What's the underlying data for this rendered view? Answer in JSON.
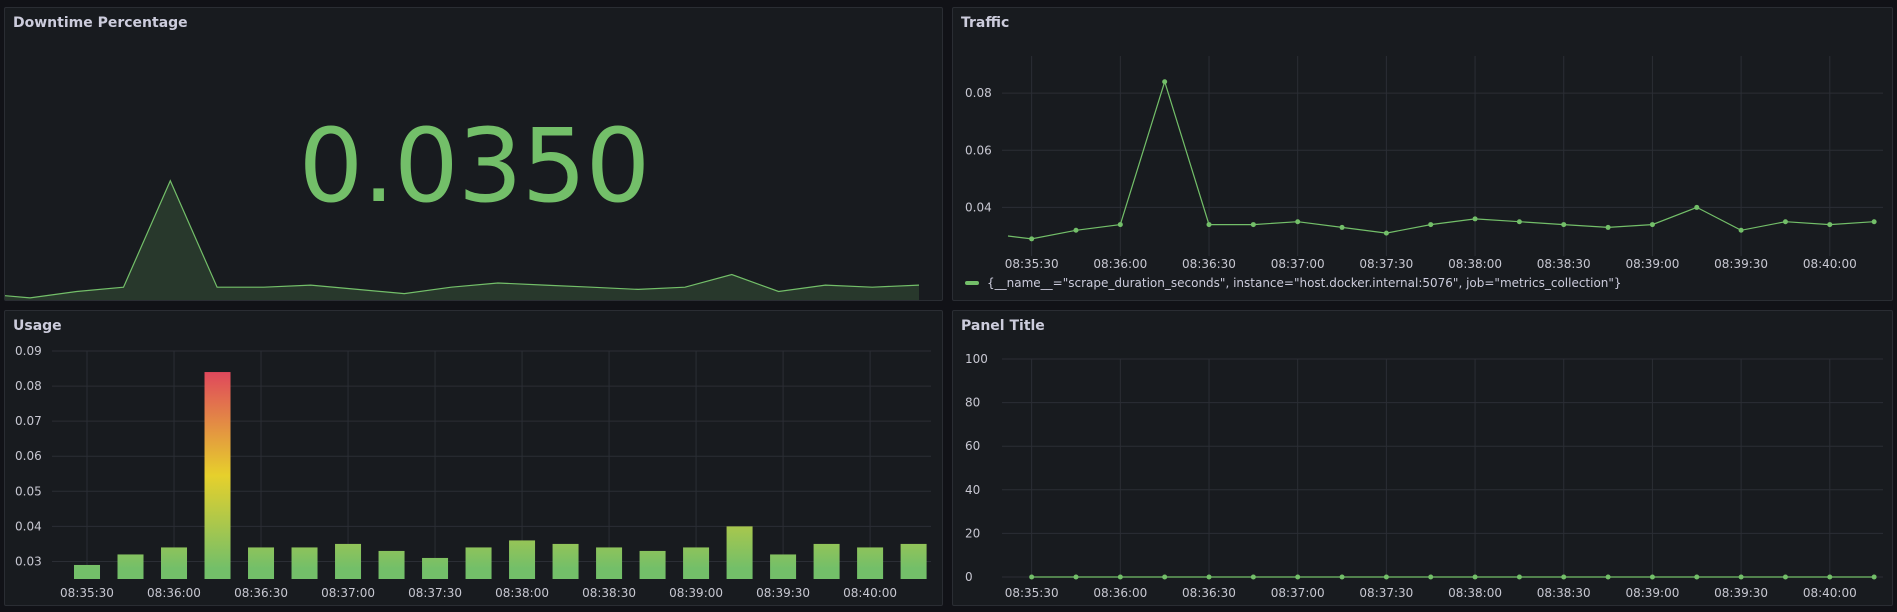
{
  "panels": {
    "downtime": {
      "title": "Downtime Percentage",
      "value": "0.0350"
    },
    "traffic": {
      "title": "Traffic",
      "legend": "{__name__=\"scrape_duration_seconds\", instance=\"host.docker.internal:5076\", job=\"metrics_collection\"}"
    },
    "usage": {
      "title": "Usage"
    },
    "panel4": {
      "title": "Panel Title"
    }
  },
  "colors": {
    "series": "#73bf69",
    "grid": "#2b2e35",
    "gradient_top": "#e0485c",
    "gradient_mid": "#e6d02c",
    "gradient_bottom": "#73bf69"
  },
  "chart_data": [
    {
      "panel": "downtime",
      "type": "area",
      "x": [
        "08:35:22",
        "08:35:30",
        "08:35:45",
        "08:36:00",
        "08:36:15",
        "08:36:30",
        "08:36:45",
        "08:37:00",
        "08:37:15",
        "08:37:30",
        "08:37:45",
        "08:38:00",
        "08:38:15",
        "08:38:30",
        "08:38:45",
        "08:39:00",
        "08:39:15",
        "08:39:30",
        "08:39:45",
        "08:40:00",
        "08:40:15"
      ],
      "values": [
        0.03,
        0.029,
        0.032,
        0.034,
        0.084,
        0.034,
        0.034,
        0.035,
        0.033,
        0.031,
        0.034,
        0.036,
        0.035,
        0.034,
        0.033,
        0.034,
        0.04,
        0.032,
        0.035,
        0.034,
        0.035
      ],
      "ylim": [
        0.028,
        0.09
      ],
      "title": "Downtime Percentage"
    },
    {
      "panel": "traffic",
      "type": "line",
      "x": [
        "08:35:22",
        "08:35:30",
        "08:35:45",
        "08:36:00",
        "08:36:15",
        "08:36:30",
        "08:36:45",
        "08:37:00",
        "08:37:15",
        "08:37:30",
        "08:37:45",
        "08:38:00",
        "08:38:15",
        "08:38:30",
        "08:38:45",
        "08:39:00",
        "08:39:15",
        "08:39:30",
        "08:39:45",
        "08:40:00",
        "08:40:15"
      ],
      "values": [
        0.03,
        0.029,
        0.032,
        0.034,
        0.084,
        0.034,
        0.034,
        0.035,
        0.033,
        0.031,
        0.034,
        0.036,
        0.035,
        0.034,
        0.033,
        0.034,
        0.04,
        0.032,
        0.035,
        0.034,
        0.035
      ],
      "points": [
        false,
        true,
        true,
        true,
        true,
        true,
        true,
        true,
        true,
        true,
        true,
        true,
        true,
        true,
        true,
        true,
        true,
        true,
        true,
        true,
        true
      ],
      "yticks": [
        "0.08",
        "0.06",
        "0.04"
      ],
      "ytick_values": [
        0.08,
        0.06,
        0.04
      ],
      "xticks": [
        "08:35:30",
        "08:36:00",
        "08:36:30",
        "08:37:00",
        "08:37:30",
        "08:38:00",
        "08:38:30",
        "08:39:00",
        "08:39:30",
        "08:40:00"
      ],
      "ylim": [
        0.023,
        0.093
      ],
      "grid": true,
      "title": "Traffic",
      "legend": "{__name__=\"scrape_duration_seconds\", instance=\"host.docker.internal:5076\", job=\"metrics_collection\"}"
    },
    {
      "panel": "usage",
      "type": "bar",
      "x": [
        "08:35:30",
        "08:35:45",
        "08:36:00",
        "08:36:15",
        "08:36:30",
        "08:36:45",
        "08:37:00",
        "08:37:15",
        "08:37:30",
        "08:37:45",
        "08:38:00",
        "08:38:15",
        "08:38:30",
        "08:38:45",
        "08:39:00",
        "08:39:15",
        "08:39:30",
        "08:39:45",
        "08:40:00",
        "08:40:15"
      ],
      "values": [
        0.029,
        0.032,
        0.034,
        0.084,
        0.034,
        0.034,
        0.035,
        0.033,
        0.031,
        0.034,
        0.036,
        0.035,
        0.034,
        0.033,
        0.034,
        0.04,
        0.032,
        0.035,
        0.034,
        0.035
      ],
      "yticks": [
        "0.09",
        "0.08",
        "0.07",
        "0.06",
        "0.05",
        "0.04",
        "0.03"
      ],
      "ytick_values": [
        0.09,
        0.08,
        0.07,
        0.06,
        0.05,
        0.04,
        0.03
      ],
      "xticks": [
        "08:35:30",
        "08:36:00",
        "08:36:30",
        "08:37:00",
        "08:37:30",
        "08:38:00",
        "08:38:30",
        "08:39:00",
        "08:39:30",
        "08:40:00"
      ],
      "ylim": [
        0.025,
        0.09
      ],
      "grid": true,
      "title": "Usage"
    },
    {
      "panel": "panel4",
      "type": "line",
      "x": [
        "08:35:30",
        "08:35:45",
        "08:36:00",
        "08:36:15",
        "08:36:30",
        "08:36:45",
        "08:37:00",
        "08:37:15",
        "08:37:30",
        "08:37:45",
        "08:38:00",
        "08:38:15",
        "08:38:30",
        "08:38:45",
        "08:39:00",
        "08:39:15",
        "08:39:30",
        "08:39:45",
        "08:40:00",
        "08:40:15"
      ],
      "values": [
        0,
        0,
        0,
        0,
        0,
        0,
        0,
        0,
        0,
        0,
        0,
        0,
        0,
        0,
        0,
        0,
        0,
        0,
        0,
        0
      ],
      "yticks": [
        "100",
        "80",
        "60",
        "40",
        "20",
        "0"
      ],
      "ytick_values": [
        100,
        80,
        60,
        40,
        20,
        0
      ],
      "xticks": [
        "08:35:30",
        "08:36:00",
        "08:36:30",
        "08:37:00",
        "08:37:30",
        "08:38:00",
        "08:38:30",
        "08:39:00",
        "08:39:30",
        "08:40:00"
      ],
      "ylim": [
        0,
        100
      ],
      "grid": true,
      "title": "Panel Title"
    }
  ]
}
